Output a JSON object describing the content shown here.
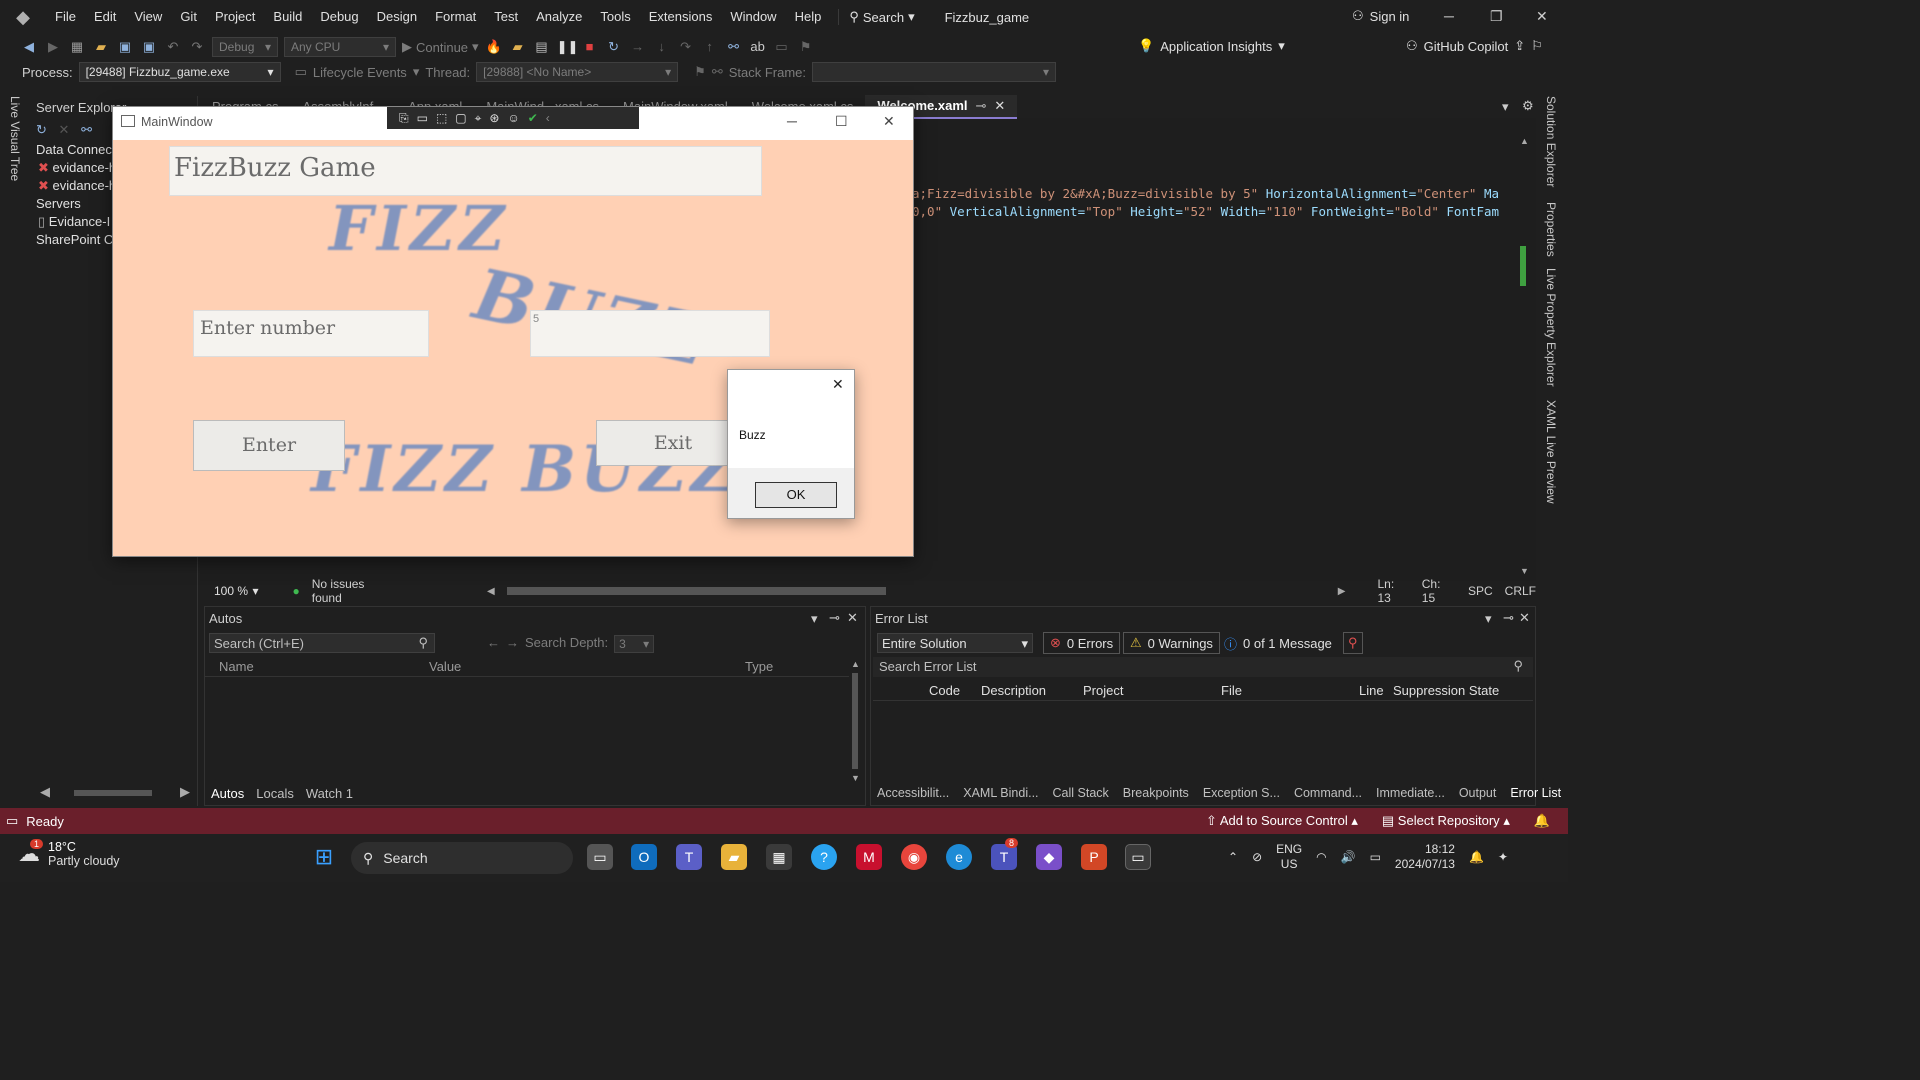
{
  "menubar": {
    "items": [
      "File",
      "Edit",
      "View",
      "Git",
      "Project",
      "Build",
      "Debug",
      "Design",
      "Format",
      "Test",
      "Analyze",
      "Tools",
      "Extensions",
      "Window",
      "Help"
    ],
    "search_label": "Search",
    "solution_title": "Fizzbuz_game",
    "sign_in": "Sign in"
  },
  "toolbar": {
    "config": "Debug",
    "platform": "Any CPU",
    "continue": "Continue",
    "app_insights": "Application Insights",
    "copilot": "GitHub Copilot"
  },
  "procbar": {
    "process_label": "Process:",
    "process_value": "[29488] Fizzbuz_game.exe",
    "lifecycle": "Lifecycle Events",
    "thread_label": "Thread:",
    "thread_value": "[29888] <No Name>",
    "stackframe_label": "Stack Frame:"
  },
  "left_strip": {
    "live_visual_tree": "Live Visual Tree"
  },
  "server_explorer": {
    "title": "Server Explorer",
    "rows": [
      "Data Connecti",
      "evidance-h",
      "evidance-h",
      "Servers",
      "Evidance-I",
      "SharePoint Co"
    ]
  },
  "editor": {
    "tabs": [
      "Program.cs",
      "AssemblyInf...",
      "App.xaml",
      "MainWind...xaml.cs",
      "MainWindow.xaml",
      "Welcome.xaml.cs"
    ],
    "active_tab": "Welcome.xaml",
    "code_line1_a": "a;Fizz=divisible by 2&#xA;Buzz=divisible by 5\"",
    "code_line1_b": " HorizontalAlignment=",
    "code_line1_c": "\"Center\"",
    "code_line1_d": " Ma",
    "code_line2_a": "0,0\"",
    "code_line2_b": " VerticalAlignment=",
    "code_line2_c": "\"Top\"",
    "code_line2_d": " Height=",
    "code_line2_e": "\"52\"",
    "code_line2_f": " Width=",
    "code_line2_g": "\"110\"",
    "code_line2_h": " FontWeight=",
    "code_line2_i": "\"Bold\"",
    "code_line2_j": " FontFam",
    "zoom": "100 %",
    "issues": "No issues found",
    "ln": "Ln: 13",
    "ch": "Ch: 15",
    "spc": "SPC",
    "crlf": "CRLF"
  },
  "right_strip": [
    "Solution Explorer",
    "Properties",
    "Live Property Explorer",
    "XAML Live Preview"
  ],
  "autos": {
    "title": "Autos",
    "search_placeholder": "Search (Ctrl+E)",
    "search_depth_label": "Search Depth:",
    "search_depth_value": "3",
    "columns": [
      "Name",
      "Value",
      "Type"
    ],
    "footer_tabs": [
      "Autos",
      "Locals",
      "Watch 1"
    ]
  },
  "error_list": {
    "title": "Error List",
    "scope": "Entire Solution",
    "errors": "0 Errors",
    "warnings": "0 Warnings",
    "messages": "0 of 1 Message",
    "search_placeholder": "Search Error List",
    "columns": [
      "Code",
      "Description",
      "Project",
      "File",
      "Line",
      "Suppression State"
    ],
    "footer_tabs": [
      "Accessibilit...",
      "XAML Bindi...",
      "Call Stack",
      "Breakpoints",
      "Exception S...",
      "Command...",
      "Immediate...",
      "Output",
      "Error List"
    ]
  },
  "statusbar": {
    "ready": "Ready",
    "add_source": "Add to Source Control",
    "select_repo": "Select Repository"
  },
  "taskbar": {
    "temperature": "18°C",
    "weather": "Partly cloudy",
    "weather_badge": "1",
    "search": "Search",
    "teams_badge": "8",
    "lang1": "ENG",
    "lang2": "US",
    "time": "18:12",
    "date": "2024/07/13"
  },
  "app_window": {
    "title": "MainWindow",
    "game_title": "FizzBuzz Game",
    "input_label": "Enter number",
    "input_value": "5",
    "enter_button": "Enter",
    "exit_button": "Exit",
    "bg_word1": "FIZZ",
    "bg_word2": "BUZZ",
    "bg_word3": "FIZZ BUZZ"
  },
  "dialog": {
    "message": "Buzz",
    "ok_button": "OK"
  },
  "colors": {
    "status_bar": "#6a1f2b",
    "app_bg": "#ffd0b4",
    "accent": "#8a7cd0"
  }
}
